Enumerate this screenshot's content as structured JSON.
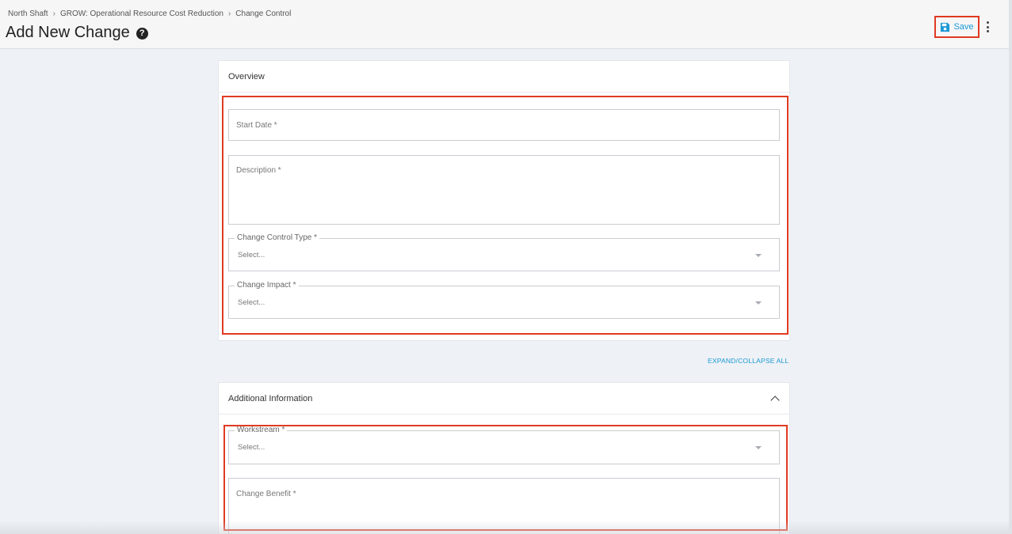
{
  "breadcrumb": [
    "North Shaft",
    "GROW: Operational Resource Cost Reduction",
    "Change Control"
  ],
  "breadcrumb_separator": "›",
  "page": {
    "title": "Add New Change",
    "help_icon": "?"
  },
  "toolbar": {
    "save_label": "Save",
    "more_menu_icon": "kebab-vertical"
  },
  "overview": {
    "header": "Overview",
    "start_date_label": "Start Date *",
    "description_label": "Description *",
    "change_control_type": {
      "label": "Change Control Type *",
      "value": "Select..."
    },
    "change_impact": {
      "label": "Change Impact *",
      "value": "Select..."
    }
  },
  "expand_collapse_label": "EXPAND/COLLAPSE ALL",
  "additional": {
    "header": "Additional Information",
    "workstream": {
      "label": "Workstream *",
      "value": "Select..."
    },
    "change_benefit_label": "Change Benefit *"
  },
  "colors": {
    "accent": "#1a9ad6",
    "highlight": "#e03a22"
  }
}
